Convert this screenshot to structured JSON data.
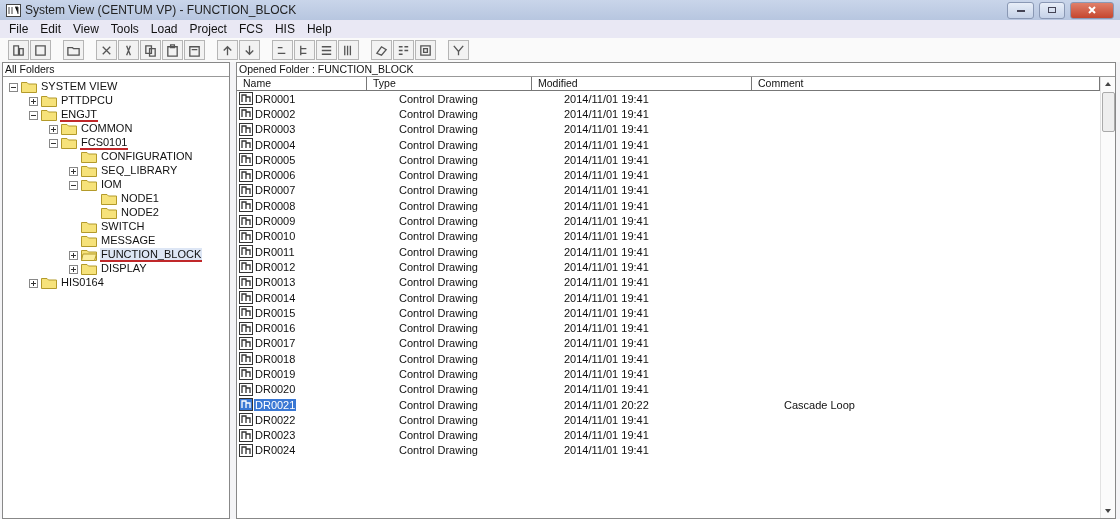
{
  "window": {
    "title": "System View (CENTUM VP) - FUNCTION_BLOCK"
  },
  "menu": [
    "File",
    "Edit",
    "View",
    "Tools",
    "Load",
    "Project",
    "FCS",
    "HIS",
    "Help"
  ],
  "tree": {
    "header": "All Folders",
    "items": [
      {
        "label": "SYSTEM VIEW",
        "kind": "branch",
        "expanded": true,
        "underlined": false,
        "children": [
          {
            "label": "PTTDPCU",
            "kind": "branch",
            "expanded": false,
            "underlined": false
          },
          {
            "label": "ENGJT",
            "kind": "branch",
            "expanded": true,
            "underlined": true,
            "children": [
              {
                "label": "COMMON",
                "kind": "branch",
                "expanded": false,
                "underlined": false
              },
              {
                "label": "FCS0101",
                "kind": "branch",
                "expanded": true,
                "underlined": true,
                "children": [
                  {
                    "label": "CONFIGURATION",
                    "kind": "leaf",
                    "underlined": false
                  },
                  {
                    "label": "SEQ_LIBRARY",
                    "kind": "branch",
                    "expanded": false,
                    "underlined": false
                  },
                  {
                    "label": "IOM",
                    "kind": "branch",
                    "expanded": true,
                    "underlined": false,
                    "children": [
                      {
                        "label": "NODE1",
                        "kind": "leaf",
                        "underlined": false
                      },
                      {
                        "label": "NODE2",
                        "kind": "leaf",
                        "underlined": false
                      }
                    ]
                  },
                  {
                    "label": "SWITCH",
                    "kind": "leaf",
                    "underlined": false
                  },
                  {
                    "label": "MESSAGE",
                    "kind": "leaf",
                    "underlined": false
                  },
                  {
                    "label": "FUNCTION_BLOCK",
                    "kind": "branch",
                    "expanded": false,
                    "underlined": true,
                    "selected": true
                  },
                  {
                    "label": "DISPLAY",
                    "kind": "branch",
                    "expanded": false,
                    "underlined": false
                  }
                ]
              }
            ]
          },
          {
            "label": "HIS0164",
            "kind": "branch",
            "expanded": false,
            "underlined": false
          }
        ]
      }
    ]
  },
  "list": {
    "opened_folder": "Opened Folder : FUNCTION_BLOCK",
    "columns": [
      "Name",
      "Type",
      "Modified",
      "Comment"
    ],
    "rows": [
      {
        "name": "DR0001",
        "type": "Control Drawing",
        "modified": "2014/11/01 19:41",
        "selected": false
      },
      {
        "name": "DR0002",
        "type": "Control Drawing",
        "modified": "2014/11/01 19:41",
        "selected": false
      },
      {
        "name": "DR0003",
        "type": "Control Drawing",
        "modified": "2014/11/01 19:41",
        "selected": false
      },
      {
        "name": "DR0004",
        "type": "Control Drawing",
        "modified": "2014/11/01 19:41",
        "selected": false
      },
      {
        "name": "DR0005",
        "type": "Control Drawing",
        "modified": "2014/11/01 19:41",
        "selected": false
      },
      {
        "name": "DR0006",
        "type": "Control Drawing",
        "modified": "2014/11/01 19:41",
        "selected": false
      },
      {
        "name": "DR0007",
        "type": "Control Drawing",
        "modified": "2014/11/01 19:41",
        "selected": false
      },
      {
        "name": "DR0008",
        "type": "Control Drawing",
        "modified": "2014/11/01 19:41",
        "selected": false
      },
      {
        "name": "DR0009",
        "type": "Control Drawing",
        "modified": "2014/11/01 19:41",
        "selected": false
      },
      {
        "name": "DR0010",
        "type": "Control Drawing",
        "modified": "2014/11/01 19:41",
        "selected": false
      },
      {
        "name": "DR0011",
        "type": "Control Drawing",
        "modified": "2014/11/01 19:41",
        "selected": false
      },
      {
        "name": "DR0012",
        "type": "Control Drawing",
        "modified": "2014/11/01 19:41",
        "selected": false
      },
      {
        "name": "DR0013",
        "type": "Control Drawing",
        "modified": "2014/11/01 19:41",
        "selected": false
      },
      {
        "name": "DR0014",
        "type": "Control Drawing",
        "modified": "2014/11/01 19:41",
        "selected": false
      },
      {
        "name": "DR0015",
        "type": "Control Drawing",
        "modified": "2014/11/01 19:41",
        "selected": false
      },
      {
        "name": "DR0016",
        "type": "Control Drawing",
        "modified": "2014/11/01 19:41",
        "selected": false
      },
      {
        "name": "DR0017",
        "type": "Control Drawing",
        "modified": "2014/11/01 19:41",
        "selected": false
      },
      {
        "name": "DR0018",
        "type": "Control Drawing",
        "modified": "2014/11/01 19:41",
        "selected": false
      },
      {
        "name": "DR0019",
        "type": "Control Drawing",
        "modified": "2014/11/01 19:41",
        "selected": false
      },
      {
        "name": "DR0020",
        "type": "Control Drawing",
        "modified": "2014/11/01 19:41",
        "selected": false
      },
      {
        "name": "DR0021",
        "type": "Control Drawing",
        "modified": "2014/11/01 20:22",
        "comment": "Cascade Loop",
        "selected": true
      },
      {
        "name": "DR0022",
        "type": "Control Drawing",
        "modified": "2014/11/01 19:41",
        "selected": false
      },
      {
        "name": "DR0023",
        "type": "Control Drawing",
        "modified": "2014/11/01 19:41",
        "selected": false
      },
      {
        "name": "DR0024",
        "type": "Control Drawing",
        "modified": "2014/11/01 19:41",
        "selected": false
      }
    ]
  }
}
